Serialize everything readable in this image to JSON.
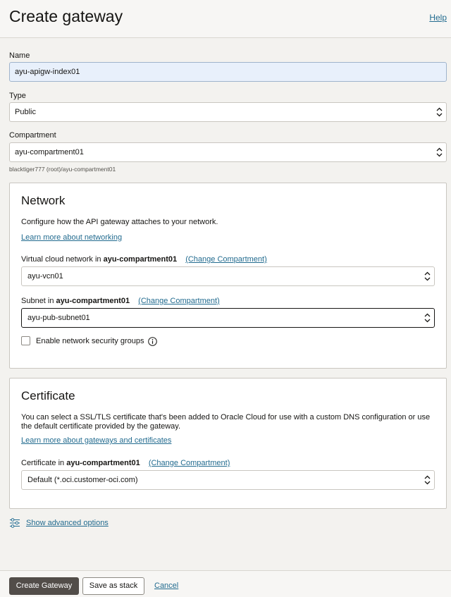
{
  "header": {
    "title": "Create gateway",
    "help": "Help"
  },
  "form": {
    "name": {
      "label": "Name",
      "value": "ayu-apigw-index01"
    },
    "type": {
      "label": "Type",
      "value": "Public"
    },
    "compartment": {
      "label": "Compartment",
      "value": "ayu-compartment01",
      "path": "blacktiger777 (root)/ayu-compartment01"
    }
  },
  "network": {
    "title": "Network",
    "description": "Configure how the API gateway attaches to your network.",
    "learn_more": "Learn more about networking",
    "vcn": {
      "label_prefix": "Virtual cloud network in",
      "compartment": "ayu-compartment01",
      "change": "(Change Compartment)",
      "value": "ayu-vcn01"
    },
    "subnet": {
      "label_prefix": "Subnet in",
      "compartment": "ayu-compartment01",
      "change": "(Change Compartment)",
      "value": "ayu-pub-subnet01"
    },
    "nsg_label": "Enable network security groups"
  },
  "certificate": {
    "title": "Certificate",
    "description": "You can select a SSL/TLS certificate that's been added to Oracle Cloud for use with a custom DNS configuration or use the default certificate provided by the gateway.",
    "learn_more": "Learn more about gateways and certificates",
    "label_prefix": "Certificate in",
    "compartment": "ayu-compartment01",
    "change": "(Change Compartment)",
    "value": "Default (*.oci.customer-oci.com)"
  },
  "advanced": "Show advanced options",
  "footer": {
    "create": "Create Gateway",
    "save_stack": "Save as stack",
    "cancel": "Cancel"
  }
}
